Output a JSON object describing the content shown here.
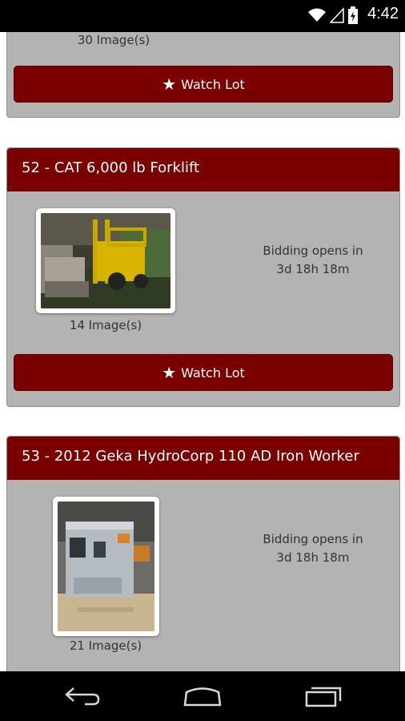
{
  "status_bar": {
    "time": "4:42",
    "icons": [
      "wifi-icon",
      "signal-icon",
      "battery-icon"
    ]
  },
  "lots": [
    {
      "title": "",
      "image_count": "30 Image(s)",
      "watch_label": "Watch Lot"
    },
    {
      "title": "52 - CAT 6,000 lb Forklift",
      "bidding_line1": "Bidding opens in",
      "bidding_line2": "3d 18h 18m",
      "image_count": "14 Image(s)",
      "watch_label": "Watch Lot"
    },
    {
      "title": "53 - 2012 Geka HydroCorp 110 AD Iron Worker",
      "bidding_line1": "Bidding opens in",
      "bidding_line2": "3d 18h 18m",
      "image_count": "21 Image(s)"
    }
  ],
  "nav_bar": {
    "buttons": [
      "back-icon",
      "home-icon",
      "recents-icon"
    ]
  },
  "colors": {
    "header": "#7a0000",
    "card_bg": "#b3b3b3"
  }
}
